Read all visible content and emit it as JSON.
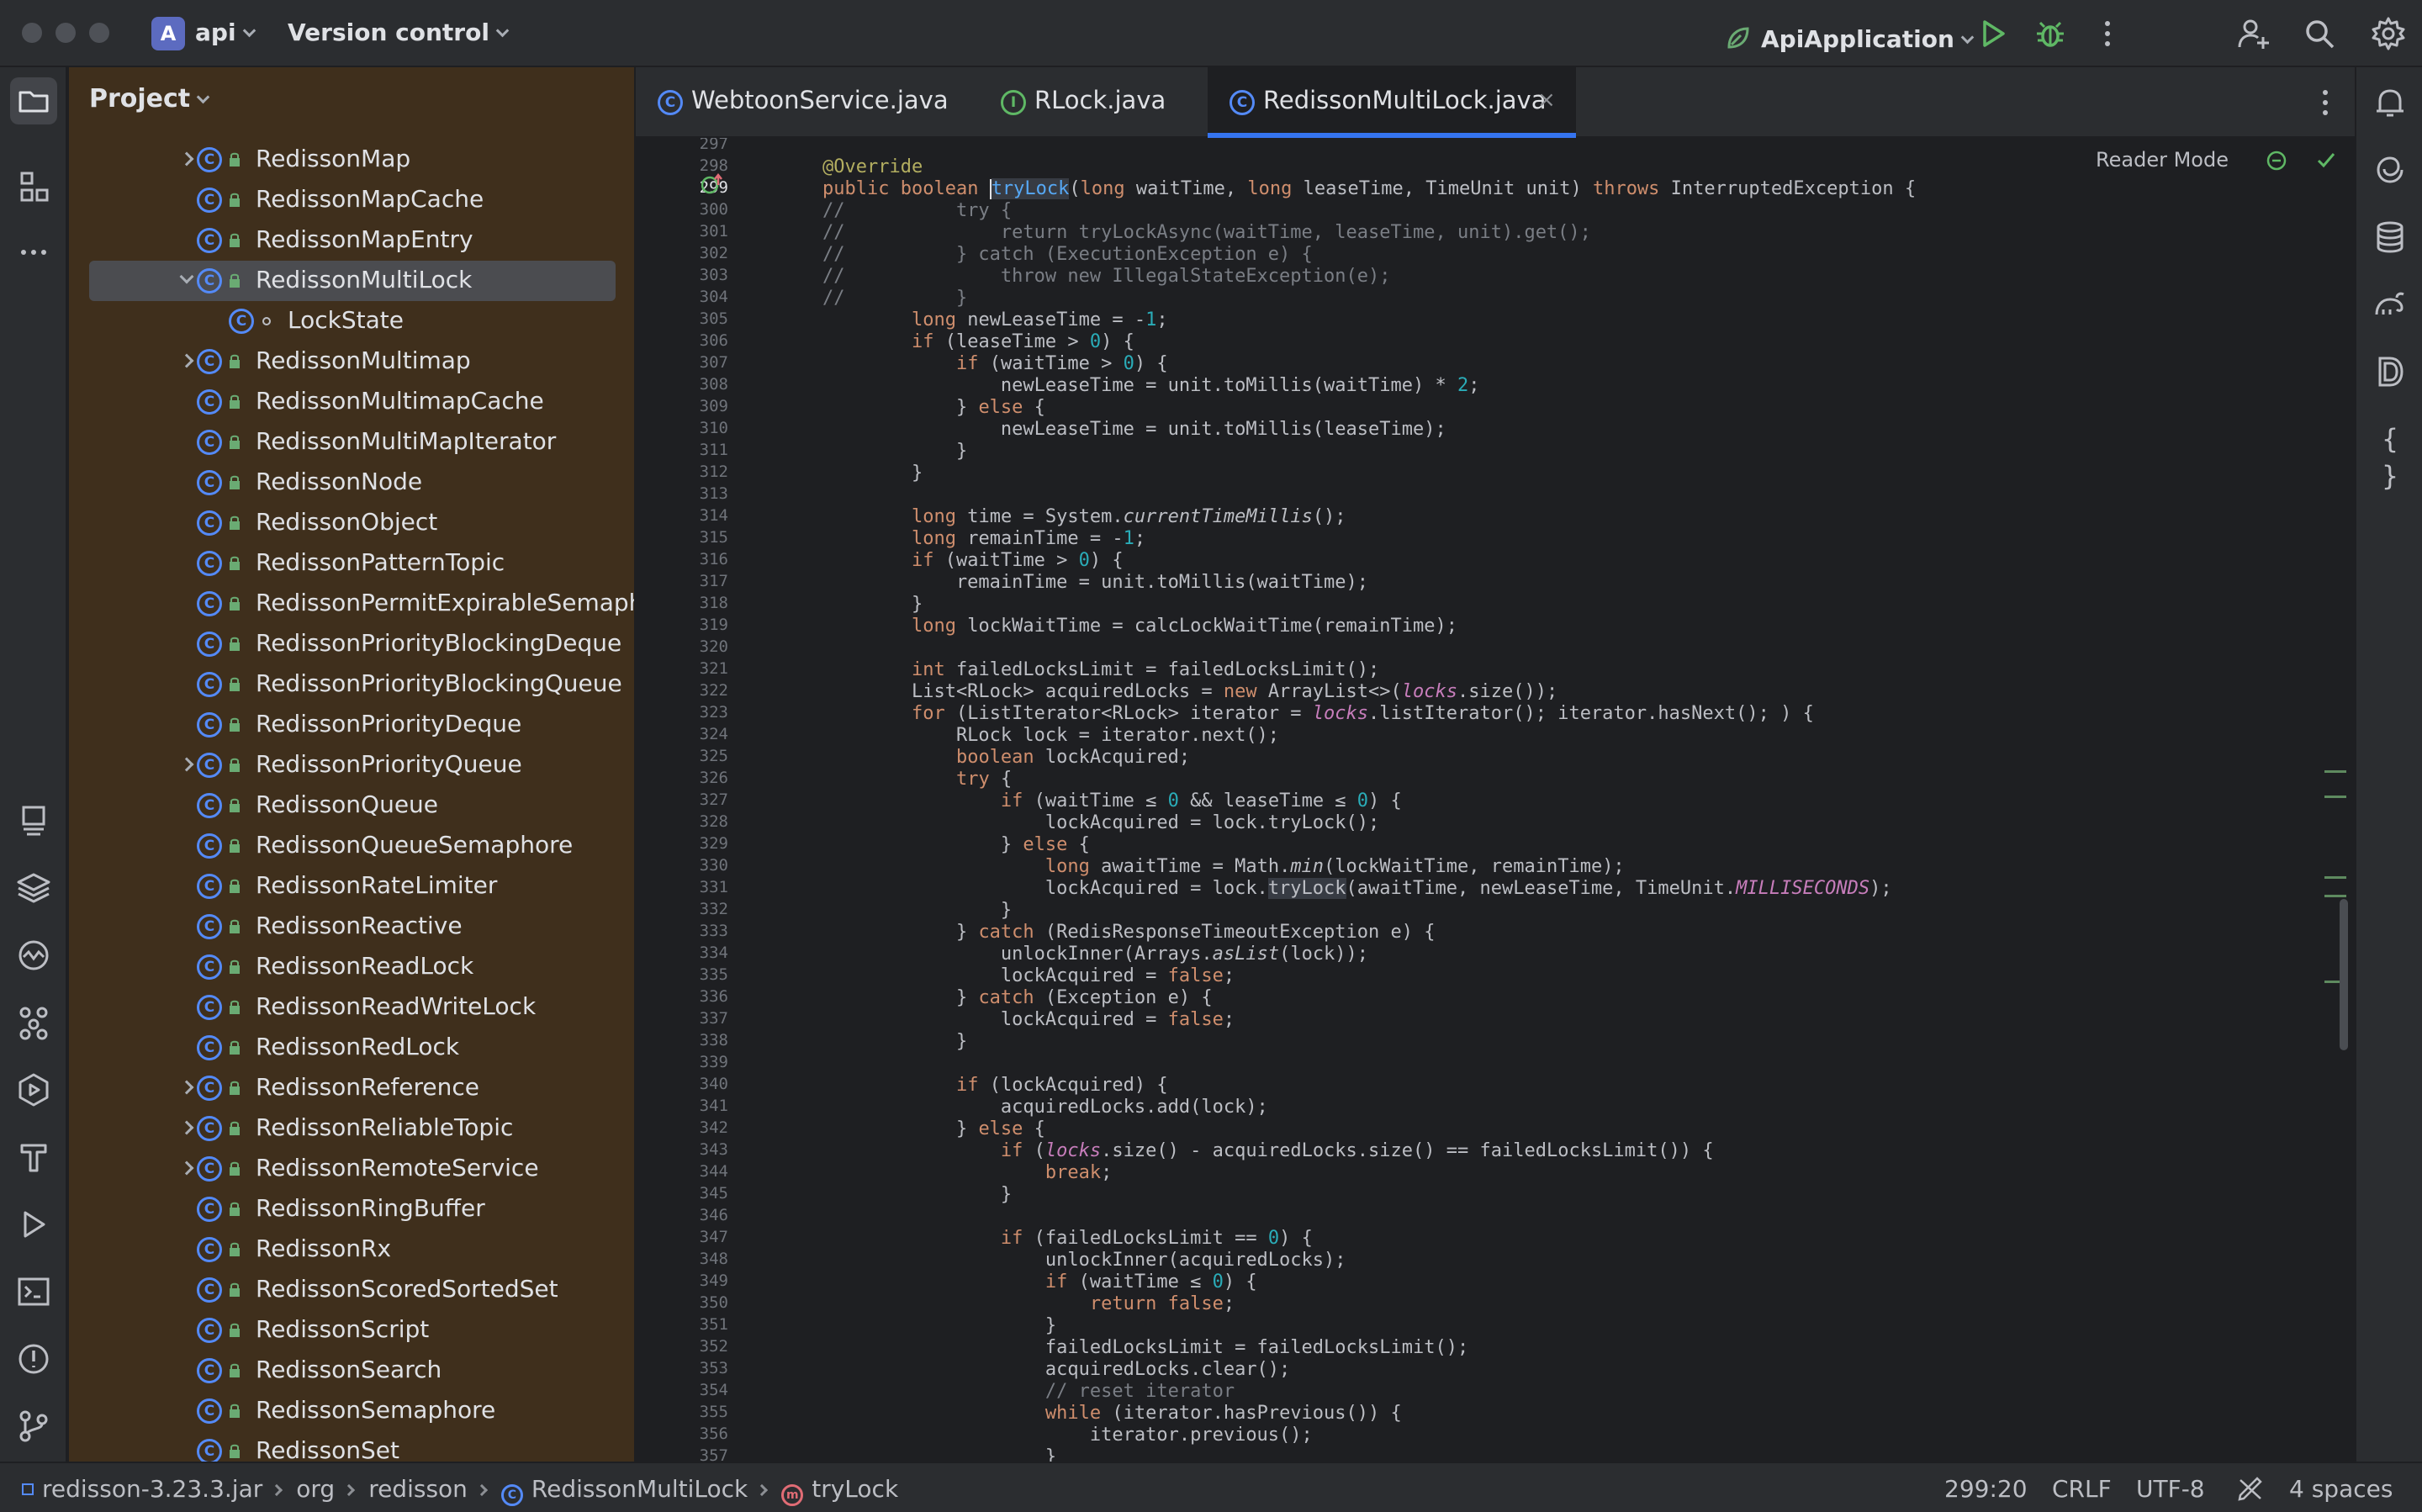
{
  "titlebar": {
    "project_badge": "A",
    "project_name": "api",
    "vcs_label": "Version control",
    "run_config": "ApiApplication"
  },
  "project_panel": {
    "title": "Project",
    "items": [
      {
        "label": "RedissonMap",
        "arrow": "collapsed",
        "indent": 0
      },
      {
        "label": "RedissonMapCache",
        "arrow": "",
        "indent": 0
      },
      {
        "label": "RedissonMapEntry",
        "arrow": "",
        "indent": 0
      },
      {
        "label": "RedissonMultiLock",
        "arrow": "expanded",
        "indent": 0,
        "selected": true
      },
      {
        "label": "LockState",
        "arrow": "",
        "indent": 1
      },
      {
        "label": "RedissonMultimap",
        "arrow": "collapsed",
        "indent": 0
      },
      {
        "label": "RedissonMultimapCache",
        "arrow": "",
        "indent": 0
      },
      {
        "label": "RedissonMultiMapIterator",
        "arrow": "",
        "indent": 0
      },
      {
        "label": "RedissonNode",
        "arrow": "",
        "indent": 0
      },
      {
        "label": "RedissonObject",
        "arrow": "",
        "indent": 0
      },
      {
        "label": "RedissonPatternTopic",
        "arrow": "",
        "indent": 0
      },
      {
        "label": "RedissonPermitExpirableSemaph",
        "arrow": "",
        "indent": 0
      },
      {
        "label": "RedissonPriorityBlockingDeque",
        "arrow": "",
        "indent": 0
      },
      {
        "label": "RedissonPriorityBlockingQueue",
        "arrow": "",
        "indent": 0
      },
      {
        "label": "RedissonPriorityDeque",
        "arrow": "",
        "indent": 0
      },
      {
        "label": "RedissonPriorityQueue",
        "arrow": "collapsed",
        "indent": 0
      },
      {
        "label": "RedissonQueue",
        "arrow": "",
        "indent": 0
      },
      {
        "label": "RedissonQueueSemaphore",
        "arrow": "",
        "indent": 0
      },
      {
        "label": "RedissonRateLimiter",
        "arrow": "",
        "indent": 0
      },
      {
        "label": "RedissonReactive",
        "arrow": "",
        "indent": 0
      },
      {
        "label": "RedissonReadLock",
        "arrow": "",
        "indent": 0
      },
      {
        "label": "RedissonReadWriteLock",
        "arrow": "",
        "indent": 0
      },
      {
        "label": "RedissonRedLock",
        "arrow": "",
        "indent": 0
      },
      {
        "label": "RedissonReference",
        "arrow": "collapsed",
        "indent": 0
      },
      {
        "label": "RedissonReliableTopic",
        "arrow": "collapsed",
        "indent": 0
      },
      {
        "label": "RedissonRemoteService",
        "arrow": "collapsed",
        "indent": 0
      },
      {
        "label": "RedissonRingBuffer",
        "arrow": "",
        "indent": 0
      },
      {
        "label": "RedissonRx",
        "arrow": "",
        "indent": 0
      },
      {
        "label": "RedissonScoredSortedSet",
        "arrow": "",
        "indent": 0
      },
      {
        "label": "RedissonScript",
        "arrow": "",
        "indent": 0
      },
      {
        "label": "RedissonSearch",
        "arrow": "",
        "indent": 0
      },
      {
        "label": "RedissonSemaphore",
        "arrow": "",
        "indent": 0
      },
      {
        "label": "RedissonSet",
        "arrow": "",
        "indent": 0
      }
    ]
  },
  "tabs": [
    {
      "label": "WebtoonService.java",
      "icon": "class"
    },
    {
      "label": "RLock.java",
      "icon": "interface"
    },
    {
      "label": "RedissonMultiLock.java",
      "icon": "class",
      "active": true
    }
  ],
  "editor": {
    "reader_mode_label": "Reader Mode",
    "first_line": 297,
    "current_line": 299,
    "lines": [
      [],
      [
        [
          "an",
          "@Override"
        ]
      ],
      [
        [
          "k",
          "public "
        ],
        [
          "k",
          "boolean "
        ],
        [
          "cursor",
          ""
        ],
        [
          "fn hl",
          "tryLock"
        ],
        [
          "",
          "("
        ],
        [
          "k",
          "long "
        ],
        [
          "",
          "waitTime, "
        ],
        [
          "k",
          "long "
        ],
        [
          "",
          "leaseTime, TimeUnit unit) "
        ],
        [
          "k",
          "throws "
        ],
        [
          "",
          "InterruptedException {"
        ]
      ],
      [
        [
          "cm",
          "//          try {"
        ]
      ],
      [
        [
          "cm",
          "//              return tryLockAsync(waitTime, leaseTime, unit).get();"
        ]
      ],
      [
        [
          "cm",
          "//          } catch (ExecutionException e) {"
        ]
      ],
      [
        [
          "cm",
          "//              throw new IllegalStateException(e);"
        ]
      ],
      [
        [
          "cm",
          "//          }"
        ]
      ],
      [
        [
          "",
          "        "
        ],
        [
          "k",
          "long "
        ],
        [
          "",
          "newLeaseTime = -"
        ],
        [
          "n",
          "1"
        ],
        [
          "",
          ";"
        ]
      ],
      [
        [
          "",
          "        "
        ],
        [
          "k",
          "if "
        ],
        [
          "",
          "(leaseTime > "
        ],
        [
          "n",
          "0"
        ],
        [
          "",
          ") {"
        ]
      ],
      [
        [
          "",
          "            "
        ],
        [
          "k",
          "if "
        ],
        [
          "",
          "(waitTime > "
        ],
        [
          "n",
          "0"
        ],
        [
          "",
          ") {"
        ]
      ],
      [
        [
          "",
          "                newLeaseTime = unit.toMillis(waitTime) * "
        ],
        [
          "n",
          "2"
        ],
        [
          "",
          ";"
        ]
      ],
      [
        [
          "",
          "            } "
        ],
        [
          "k",
          "else "
        ],
        [
          "",
          "{"
        ]
      ],
      [
        [
          "",
          "                newLeaseTime = unit.toMillis(leaseTime);"
        ]
      ],
      [
        [
          "",
          "            }"
        ]
      ],
      [
        [
          "",
          "        }"
        ]
      ],
      [],
      [
        [
          "",
          "        "
        ],
        [
          "k",
          "long "
        ],
        [
          "",
          "time = System."
        ],
        [
          "it",
          "currentTimeMillis"
        ],
        [
          "",
          "();"
        ]
      ],
      [
        [
          "",
          "        "
        ],
        [
          "k",
          "long "
        ],
        [
          "",
          "remainTime = -"
        ],
        [
          "n",
          "1"
        ],
        [
          "",
          ";"
        ]
      ],
      [
        [
          "",
          "        "
        ],
        [
          "k",
          "if "
        ],
        [
          "",
          "(waitTime > "
        ],
        [
          "n",
          "0"
        ],
        [
          "",
          ") {"
        ]
      ],
      [
        [
          "",
          "            remainTime = unit.toMillis(waitTime);"
        ]
      ],
      [
        [
          "",
          "        }"
        ]
      ],
      [
        [
          "",
          "        "
        ],
        [
          "k",
          "long "
        ],
        [
          "",
          "lockWaitTime = calcLockWaitTime(remainTime);"
        ]
      ],
      [],
      [
        [
          "",
          "        "
        ],
        [
          "k",
          "int "
        ],
        [
          "",
          "failedLocksLimit = failedLocksLimit();"
        ]
      ],
      [
        [
          "",
          "        List<RLock> acquiredLocks = "
        ],
        [
          "k",
          "new "
        ],
        [
          "",
          "ArrayList<>("
        ],
        [
          "cst",
          "locks"
        ],
        [
          "",
          ".size());"
        ]
      ],
      [
        [
          "",
          "        "
        ],
        [
          "k",
          "for "
        ],
        [
          "",
          "(ListIterator<RLock> iterator = "
        ],
        [
          "cst",
          "locks"
        ],
        [
          "",
          ".listIterator(); iterator.hasNext(); ) {"
        ]
      ],
      [
        [
          "",
          "            RLock lock = iterator.next();"
        ]
      ],
      [
        [
          "",
          "            "
        ],
        [
          "k",
          "boolean "
        ],
        [
          "",
          "lockAcquired;"
        ]
      ],
      [
        [
          "",
          "            "
        ],
        [
          "k",
          "try "
        ],
        [
          "",
          "{"
        ]
      ],
      [
        [
          "",
          "                "
        ],
        [
          "k",
          "if "
        ],
        [
          "",
          "(waitTime ≤ "
        ],
        [
          "n",
          "0"
        ],
        [
          "",
          " && leaseTime ≤ "
        ],
        [
          "n",
          "0"
        ],
        [
          "",
          ") {"
        ]
      ],
      [
        [
          "",
          "                    lockAcquired = lock.tryLock();"
        ]
      ],
      [
        [
          "",
          "                } "
        ],
        [
          "k",
          "else "
        ],
        [
          "",
          "{"
        ]
      ],
      [
        [
          "",
          "                    "
        ],
        [
          "k",
          "long "
        ],
        [
          "",
          "awaitTime = Math."
        ],
        [
          "it",
          "min"
        ],
        [
          "",
          "(lockWaitTime, remainTime);"
        ]
      ],
      [
        [
          "",
          "                    lockAcquired = lock."
        ],
        [
          "hl",
          "tryLock"
        ],
        [
          "",
          "(awaitTime, newLeaseTime, TimeUnit."
        ],
        [
          "cst",
          "MILLISECONDS"
        ],
        [
          "",
          ");"
        ]
      ],
      [
        [
          "",
          "                }"
        ]
      ],
      [
        [
          "",
          "            } "
        ],
        [
          "k",
          "catch "
        ],
        [
          "",
          "(RedisResponseTimeoutException e) {"
        ]
      ],
      [
        [
          "",
          "                unlockInner(Arrays."
        ],
        [
          "it",
          "asList"
        ],
        [
          "",
          "(lock));"
        ]
      ],
      [
        [
          "",
          "                lockAcquired = "
        ],
        [
          "k",
          "false"
        ],
        [
          "",
          ";"
        ]
      ],
      [
        [
          "",
          "            } "
        ],
        [
          "k",
          "catch "
        ],
        [
          "",
          "(Exception e) {"
        ]
      ],
      [
        [
          "",
          "                lockAcquired = "
        ],
        [
          "k",
          "false"
        ],
        [
          "",
          ";"
        ]
      ],
      [
        [
          "",
          "            }"
        ]
      ],
      [],
      [
        [
          "",
          "            "
        ],
        [
          "k",
          "if "
        ],
        [
          "",
          "(lockAcquired) {"
        ]
      ],
      [
        [
          "",
          "                acquiredLocks.add(lock);"
        ]
      ],
      [
        [
          "",
          "            } "
        ],
        [
          "k",
          "else "
        ],
        [
          "",
          "{"
        ]
      ],
      [
        [
          "",
          "                "
        ],
        [
          "k",
          "if "
        ],
        [
          "",
          "("
        ],
        [
          "cst",
          "locks"
        ],
        [
          "",
          ".size() - acquiredLocks.size() == failedLocksLimit()) {"
        ]
      ],
      [
        [
          "",
          "                    "
        ],
        [
          "k",
          "break"
        ],
        [
          "",
          ";"
        ]
      ],
      [
        [
          "",
          "                }"
        ]
      ],
      [],
      [
        [
          "",
          "                "
        ],
        [
          "k",
          "if "
        ],
        [
          "",
          "(failedLocksLimit == "
        ],
        [
          "n",
          "0"
        ],
        [
          "",
          ") {"
        ]
      ],
      [
        [
          "",
          "                    unlockInner(acquiredLocks);"
        ]
      ],
      [
        [
          "",
          "                    "
        ],
        [
          "k",
          "if "
        ],
        [
          "",
          "(waitTime ≤ "
        ],
        [
          "n",
          "0"
        ],
        [
          "",
          ") {"
        ]
      ],
      [
        [
          "",
          "                        "
        ],
        [
          "k",
          "return false"
        ],
        [
          "",
          ";"
        ]
      ],
      [
        [
          "",
          "                    }"
        ]
      ],
      [
        [
          "",
          "                    failedLocksLimit = failedLocksLimit();"
        ]
      ],
      [
        [
          "",
          "                    acquiredLocks.clear();"
        ]
      ],
      [
        [
          "",
          "                    "
        ],
        [
          "cm",
          "// reset iterator"
        ]
      ],
      [
        [
          "",
          "                    "
        ],
        [
          "k",
          "while "
        ],
        [
          "",
          "(iterator.hasPrevious()) {"
        ]
      ],
      [
        [
          "",
          "                        iterator.previous();"
        ]
      ],
      [
        [
          "",
          "                    }"
        ]
      ]
    ]
  },
  "statusbar": {
    "breadcrumb": [
      "redisson-3.23.3.jar",
      "org",
      "redisson",
      "RedissonMultiLock",
      "tryLock"
    ],
    "position": "299:20",
    "line_separator": "CRLF",
    "encoding": "UTF-8",
    "indent": "4 spaces"
  },
  "colors": {
    "accent": "#3574f0",
    "panel_bg": "#3f2f1c",
    "editor_bg": "#1e1f22"
  }
}
